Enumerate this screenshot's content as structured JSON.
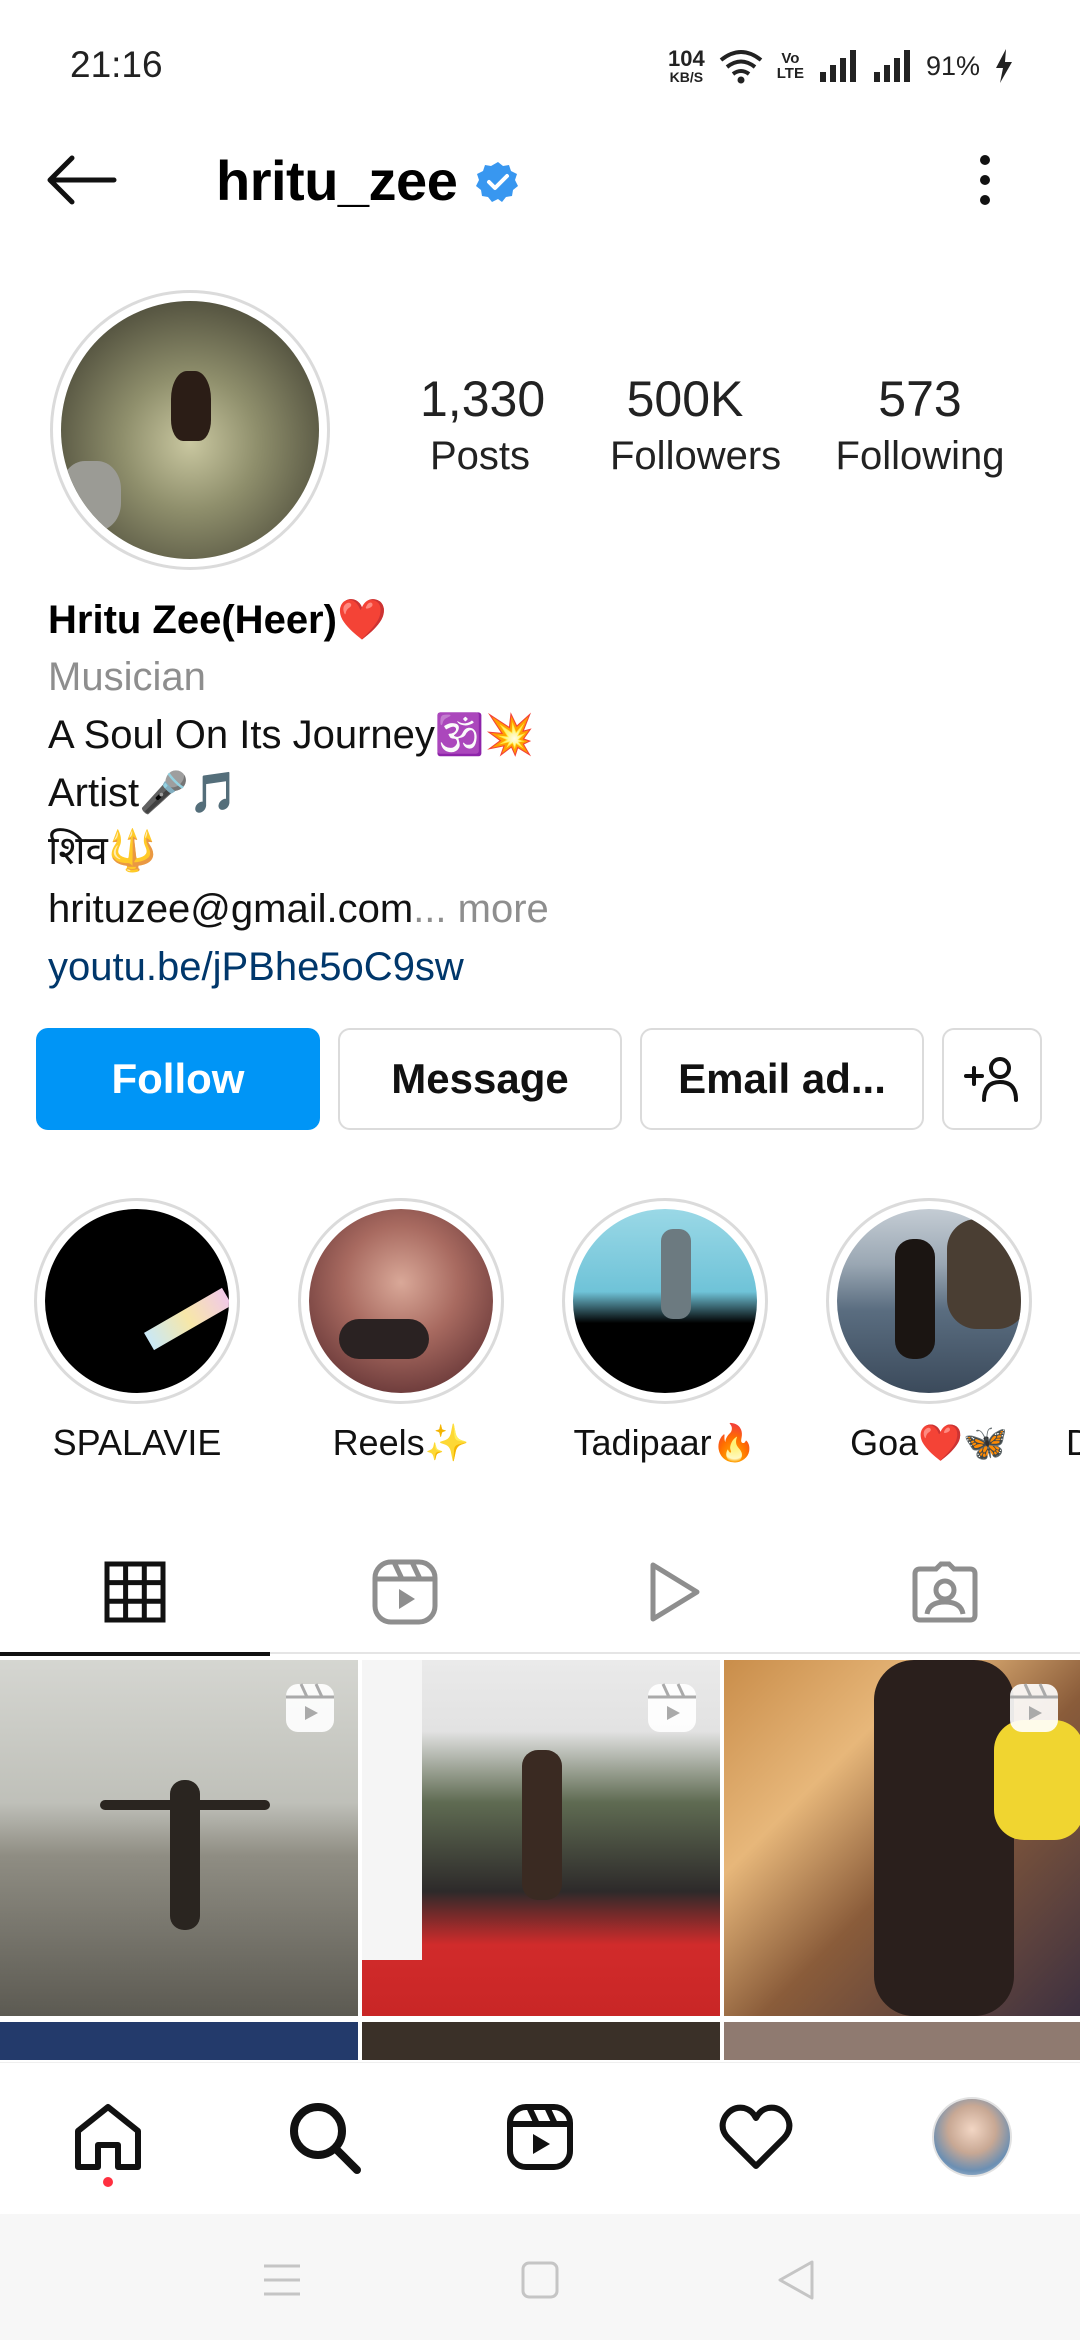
{
  "status_bar": {
    "time": "21:16",
    "net_speed_value": "104",
    "net_speed_unit": "KB/S",
    "volte_top": "Vo",
    "volte_bottom": "LTE",
    "battery": "91%"
  },
  "header": {
    "username": "hritu_zee",
    "verified": true,
    "back_icon": "arrow-left-icon",
    "more_icon": "more-vertical-icon"
  },
  "stats": [
    {
      "value": "1,330",
      "label": "Posts"
    },
    {
      "value": "500K",
      "label": "Followers"
    },
    {
      "value": "573",
      "label": "Following"
    }
  ],
  "bio": {
    "name": "Hritu Zee(Heer)❤️",
    "category": "Musician",
    "lines": [
      "A Soul On Its Journey🕉️💥",
      "Artist🎤🎵",
      "शिव🔱"
    ],
    "email": "hrituzee@gmail.com",
    "more_label": "... more",
    "link": "youtu.be/jPBhe5oC9sw"
  },
  "actions": {
    "follow": "Follow",
    "message": "Message",
    "email": "Email ad...",
    "add_person_icon": "add-person-icon"
  },
  "highlights": [
    {
      "label": "SPALAVIE"
    },
    {
      "label": "Reels✨"
    },
    {
      "label": "Tadipaar🔥"
    },
    {
      "label": "Goa❤️🦋"
    },
    {
      "label": "D"
    }
  ],
  "tabs": [
    {
      "name": "grid",
      "icon": "grid-icon",
      "active": true
    },
    {
      "name": "reels",
      "icon": "reels-icon",
      "active": false
    },
    {
      "name": "videos",
      "icon": "play-icon",
      "active": false
    },
    {
      "name": "tagged",
      "icon": "tagged-icon",
      "active": false
    }
  ],
  "bottom_nav": [
    "home-icon",
    "search-icon",
    "reels-icon",
    "heart-icon",
    "profile-avatar"
  ],
  "colors": {
    "accent": "#0095f6",
    "link": "#00376b",
    "secondary_text": "#8e8e8e",
    "verified": "#3897f0",
    "notification_dot": "#ff3040"
  }
}
